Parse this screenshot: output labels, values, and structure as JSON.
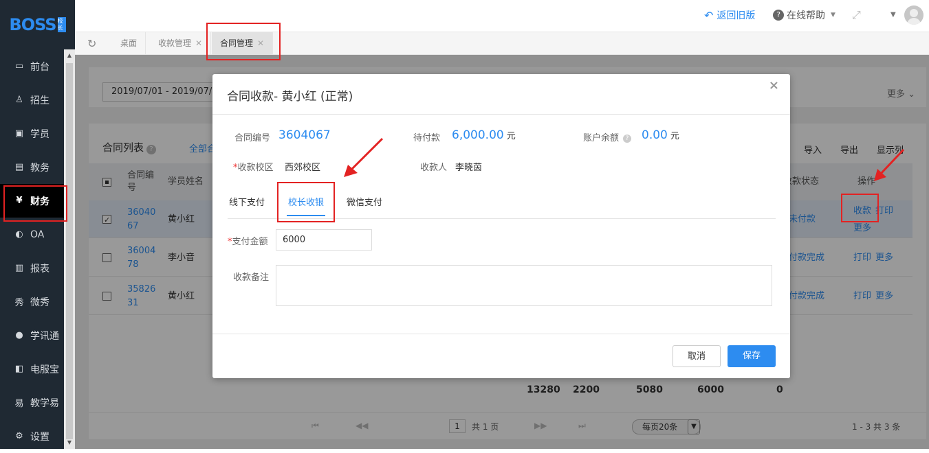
{
  "logo": {
    "text": "BOSS",
    "badge": "校长"
  },
  "sidebar": {
    "items": [
      {
        "label": "前台",
        "icon": "calendar-icon"
      },
      {
        "label": "招生",
        "icon": "user-add-icon"
      },
      {
        "label": "学员",
        "icon": "id-card-icon"
      },
      {
        "label": "教务",
        "icon": "book-icon"
      },
      {
        "label": "财务",
        "icon": "yen-icon"
      },
      {
        "label": "OA",
        "icon": "toggle-icon"
      },
      {
        "label": "报表",
        "icon": "bar-chart-icon"
      },
      {
        "label": "微秀",
        "icon": "xiu-icon"
      },
      {
        "label": "学讯通",
        "icon": "location-icon"
      },
      {
        "label": "电服宝",
        "icon": "phone-icon"
      },
      {
        "label": "教学易",
        "icon": "teach-icon"
      },
      {
        "label": "设置",
        "icon": "gear-icon"
      }
    ],
    "active": "财务"
  },
  "header": {
    "back_label": "返回旧版",
    "help_label": "在线帮助"
  },
  "tabs": [
    {
      "label": "桌面"
    },
    {
      "label": "收款管理"
    },
    {
      "label": "合同管理"
    }
  ],
  "filter": {
    "date_range": "2019/07/01 - 2019/07/0",
    "more_label": "更多"
  },
  "list": {
    "title": "合同列表",
    "all_tab": "全部合",
    "tools": [
      "导入",
      "导出",
      "显示列"
    ],
    "headers": {
      "contract_no": "合同编号",
      "student": "学员姓名",
      "status": "收款状态",
      "ops": "操作"
    },
    "rows": [
      {
        "no_line1": "36040",
        "no_line2": "67",
        "student": "黄小红",
        "status": "未付款",
        "ops": [
          "收款",
          "打印",
          "更多"
        ],
        "checked": true
      },
      {
        "no_line1": "36004",
        "no_line2": "78",
        "student": "李小音",
        "status": "付款完成",
        "ops": [
          "打印",
          "更多"
        ],
        "checked": false
      },
      {
        "no_line1": "35826",
        "no_line2": "31",
        "student": "黄小红",
        "status": "付款完成",
        "ops": [
          "打印",
          "更多"
        ],
        "checked": false
      }
    ],
    "totals": [
      "13280",
      "2200",
      "5080",
      "6000",
      "0"
    ]
  },
  "pager": {
    "page": "1",
    "total_pages": "共 1 页",
    "per_page": "每页20条",
    "summary": "1 - 3  共 3 条"
  },
  "modal": {
    "title": "合同收款- 黄小红 (正常)",
    "contract_no_label": "合同编号",
    "contract_no": "3604067",
    "due_label": "待付款",
    "due_amount": "6,000.00",
    "balance_label": "账户余额",
    "balance": "0.00",
    "unit": "元",
    "campus_label": "收款校区",
    "campus": "西郊校区",
    "payee_label": "收款人",
    "payee": "李晓茵",
    "pay_tabs": [
      "线下支付",
      "校长收银",
      "微信支付"
    ],
    "amount_label": "支付金额",
    "amount": "6000",
    "note_label": "收款备注",
    "cancel_label": "取消",
    "save_label": "保存"
  },
  "colors": {
    "accent": "#2d8cf0",
    "sidebar_bg": "#1f2933",
    "annotation": "#e32222"
  }
}
